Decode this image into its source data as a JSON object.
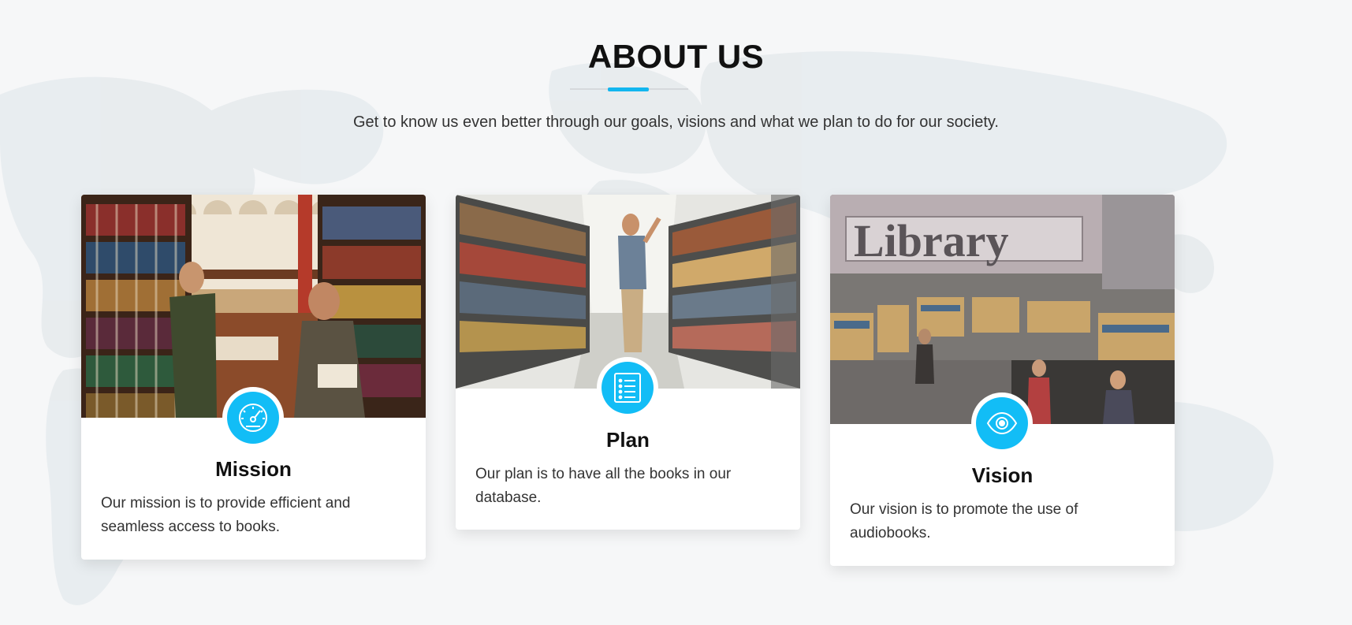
{
  "section": {
    "title": "ABOUT US",
    "subtitle": "Get to know us even better through our goals, visions and what we plan to do for our society."
  },
  "colors": {
    "accent": "#12bdf6",
    "background": "#f6f7f8",
    "card": "#ffffff"
  },
  "cards": [
    {
      "title": "Mission",
      "text": "Our mission is to provide efficient and seamless access to books.",
      "icon": "speedometer-icon",
      "image": "library-stacks-photo"
    },
    {
      "title": "Plan",
      "text": "Our plan is to have all the books in our database.",
      "icon": "list-document-icon",
      "image": "bookshelf-aisle-photo"
    },
    {
      "title": "Vision",
      "text": "Our vision is to promote the use of audiobooks.",
      "icon": "eye-icon",
      "image": "library-interior-photo",
      "image_sign": "Library"
    }
  ]
}
